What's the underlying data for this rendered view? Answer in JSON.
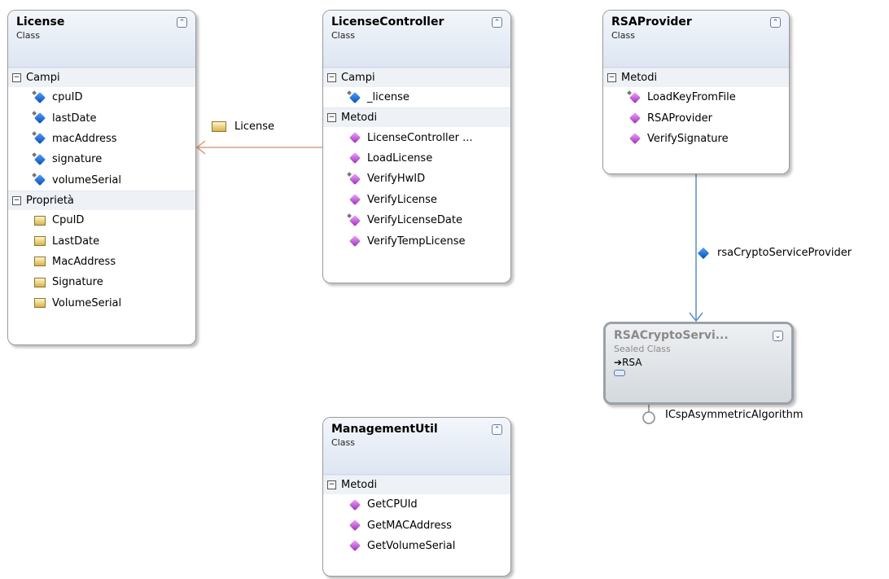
{
  "classes": {
    "license": {
      "name": "License",
      "stereotype": "Class",
      "sections": [
        {
          "title": "Campi",
          "members": [
            {
              "name": "cpuID",
              "kind": "field"
            },
            {
              "name": "lastDate",
              "kind": "field"
            },
            {
              "name": "macAddress",
              "kind": "field"
            },
            {
              "name": "signature",
              "kind": "field"
            },
            {
              "name": "volumeSerial",
              "kind": "field"
            }
          ]
        },
        {
          "title": "Proprietà",
          "members": [
            {
              "name": "CpuID",
              "kind": "prop"
            },
            {
              "name": "LastDate",
              "kind": "prop"
            },
            {
              "name": "MacAddress",
              "kind": "prop"
            },
            {
              "name": "Signature",
              "kind": "prop"
            },
            {
              "name": "VolumeSerial",
              "kind": "prop"
            }
          ]
        }
      ]
    },
    "licenseController": {
      "name": "LicenseController",
      "stereotype": "Class",
      "sections": [
        {
          "title": "Campi",
          "members": [
            {
              "name": "_license",
              "kind": "field"
            }
          ]
        },
        {
          "title": "Metodi",
          "members": [
            {
              "name": "LicenseController ...",
              "kind": "method"
            },
            {
              "name": "LoadLicense",
              "kind": "method"
            },
            {
              "name": "VerifyHwID",
              "kind": "method"
            },
            {
              "name": "VerifyLicense",
              "kind": "method"
            },
            {
              "name": "VerifyLicenseDate",
              "kind": "method"
            },
            {
              "name": "VerifyTempLicense",
              "kind": "method"
            }
          ]
        }
      ]
    },
    "rsaProvider": {
      "name": "RSAProvider",
      "stereotype": "Class",
      "sections": [
        {
          "title": "Metodi",
          "members": [
            {
              "name": "LoadKeyFromFile",
              "kind": "method"
            },
            {
              "name": "RSAProvider",
              "kind": "method"
            },
            {
              "name": "VerifySignature",
              "kind": "method"
            }
          ]
        }
      ]
    },
    "managementUtil": {
      "name": "ManagementUtil",
      "stereotype": "Class",
      "sections": [
        {
          "title": "Metodi",
          "members": [
            {
              "name": "GetCPUId",
              "kind": "method"
            },
            {
              "name": "GetMACAddress",
              "kind": "method"
            },
            {
              "name": "GetVolumeSerial",
              "kind": "method"
            }
          ]
        }
      ]
    },
    "rsaCrypto": {
      "name": "RSACryptoServi...",
      "stereotype": "Sealed Class",
      "base": "RSA"
    }
  },
  "associations": {
    "license_label": "License",
    "rsa_label": "rsaCryptoServiceProvider",
    "interface_label": "ICspAsymmetricAlgorithm"
  },
  "colors": {
    "association_orange": "#d9a27e",
    "association_blue": "#5b8fc7"
  }
}
